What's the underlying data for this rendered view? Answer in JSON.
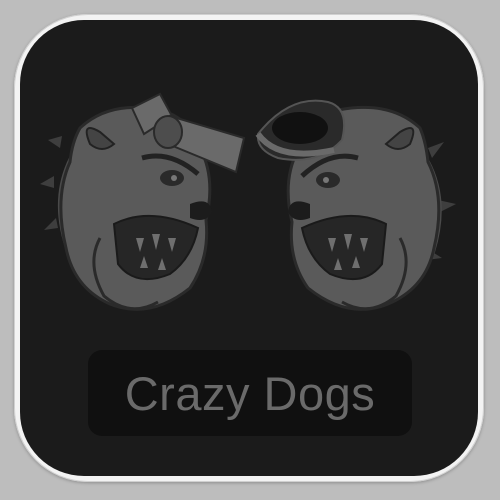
{
  "app": {
    "label": "Crazy Dogs"
  },
  "icons": {
    "left_mascot": "bulldog-with-bow-icon",
    "right_mascot": "bulldog-with-spiked-collar-icon"
  },
  "colors": {
    "frame": "#f3f3f3",
    "face": "#1b1b1b",
    "mascot": "#5a5a5a",
    "label_text": "#6a6a6a"
  }
}
